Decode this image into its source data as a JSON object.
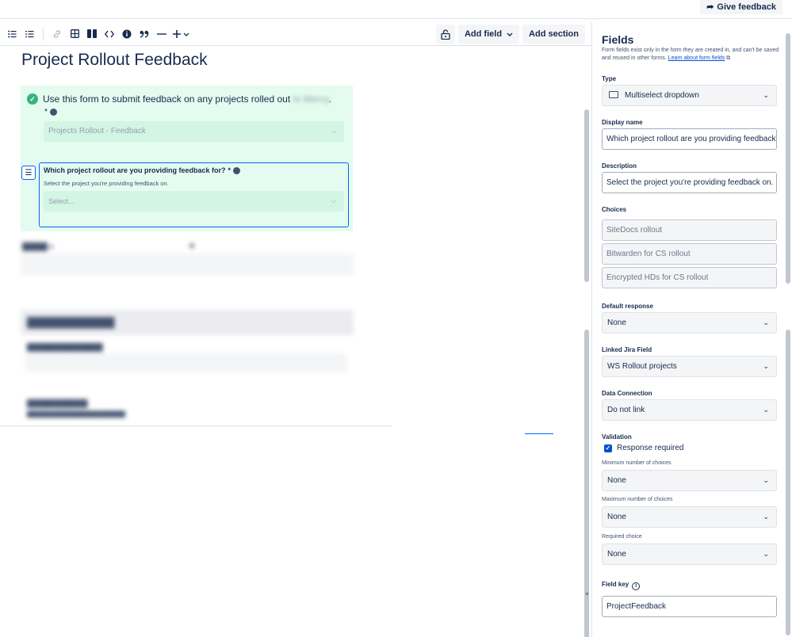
{
  "topbar": {
    "feedback_label": "Give feedback"
  },
  "toolbar": {
    "icons": [
      "bullet-list-icon",
      "numbered-list-icon",
      "link-icon",
      "table-icon",
      "columns-icon",
      "code-icon",
      "info-icon",
      "quote-icon",
      "divider-icon",
      "insert-plus-icon"
    ],
    "add_field_label": "Add field",
    "add_section_label": "Add section"
  },
  "form": {
    "title": "Project Rollout Feedback",
    "intro_text": "Use this form to submit feedback on any projects rolled out",
    "intro_suffix": ".",
    "required_star": "*",
    "first_select_value": "Projects Rollout - Feedback",
    "active_field": {
      "question": "Which project rollout are you providing feedback for?",
      "required_star": "*",
      "description": "Select the project you're providing feedback on.",
      "placeholder": "Select..."
    }
  },
  "panel": {
    "title": "Fields",
    "description": "Form fields exist only in the form they are created in, and can't be saved and reused in other forms.",
    "learn_link": "Learn about form fields",
    "type_label": "Type",
    "type_value": "Multiselect dropdown",
    "display_name_label": "Display name",
    "display_name_value": "Which project rollout are you providing feedback f",
    "description_label": "Description",
    "description_value": "Select the project you're providing feedback on.",
    "choices_label": "Choices",
    "choices": [
      "SiteDocs rollout",
      "Bitwarden for CS rollout",
      "Encrypted HDs for CS rollout"
    ],
    "default_response_label": "Default response",
    "default_response_value": "None",
    "linked_jira_label": "Linked Jira Field",
    "linked_jira_value": "WS Rollout projects",
    "data_connection_label": "Data Connection",
    "data_connection_value": "Do not link",
    "validation_label": "Validation",
    "response_required_label": "Response required",
    "min_choices_label": "Minimum number of choices",
    "min_choices_value": "None",
    "max_choices_label": "Maximum number of choices",
    "max_choices_value": "None",
    "required_choice_label": "Required choice",
    "required_choice_value": "None",
    "field_key_label": "Field key",
    "field_key_value": "ProjectFeedback"
  },
  "colors": {
    "accent": "#0052cc",
    "selection_bg": "#e3fcef",
    "check_green": "#36b37e",
    "focus_border": "#0065ff"
  }
}
